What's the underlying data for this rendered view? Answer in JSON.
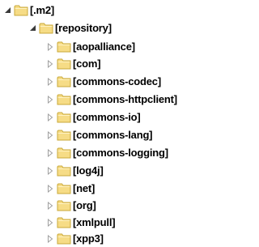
{
  "tree": {
    "root": {
      "label": "[.m2]",
      "expanded": true,
      "toggle_icon": "expanded-triangle-icon",
      "folder_icon": "folder-icon"
    },
    "repository": {
      "label": "[repository]",
      "expanded": true,
      "toggle_icon": "expanded-triangle-icon",
      "folder_icon": "folder-icon"
    },
    "children": [
      {
        "label": "[aopalliance]",
        "expanded": false
      },
      {
        "label": "[com]",
        "expanded": false
      },
      {
        "label": "[commons-codec]",
        "expanded": false
      },
      {
        "label": "[commons-httpclient]",
        "expanded": false
      },
      {
        "label": "[commons-io]",
        "expanded": false
      },
      {
        "label": "[commons-lang]",
        "expanded": false
      },
      {
        "label": "[commons-logging]",
        "expanded": false
      },
      {
        "label": "[log4j]",
        "expanded": false
      },
      {
        "label": "[net]",
        "expanded": false
      },
      {
        "label": "[org]",
        "expanded": false
      },
      {
        "label": "[xmlpull]",
        "expanded": false
      },
      {
        "label": "[xpp3]",
        "expanded": false
      }
    ],
    "colors": {
      "folder_fill": "#f6dc86",
      "folder_stroke": "#c9a93a",
      "collapsed_arrow": "#a0a0a0",
      "expanded_arrow": "#3a3a3a",
      "text": "#000000"
    }
  }
}
